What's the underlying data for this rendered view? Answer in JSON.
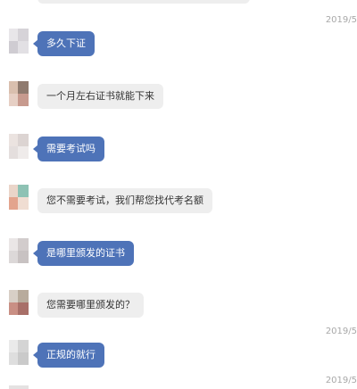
{
  "conversation": {
    "messages": [
      {
        "id": "m1",
        "sender": "customer",
        "text": "多久下证"
      },
      {
        "id": "m2",
        "sender": "agent",
        "text": "一个月左右证书就能下来"
      },
      {
        "id": "m3",
        "sender": "customer",
        "text": "需要考试吗"
      },
      {
        "id": "m4",
        "sender": "agent",
        "text": "您不需要考试，我们帮您找代考名额"
      },
      {
        "id": "m5",
        "sender": "customer",
        "text": "是哪里颁发的证书"
      },
      {
        "id": "m6",
        "sender": "agent",
        "text": "您需要哪里颁发的？"
      },
      {
        "id": "m7",
        "sender": "customer",
        "text": "正规的就行"
      }
    ],
    "timestamps": [
      "2019/5",
      "2019/5",
      "2019/5"
    ]
  },
  "colors": {
    "customer_bubble": "#4e73b8",
    "agent_bubble": "#eeeeee",
    "timestamp": "#a8a8a8"
  }
}
